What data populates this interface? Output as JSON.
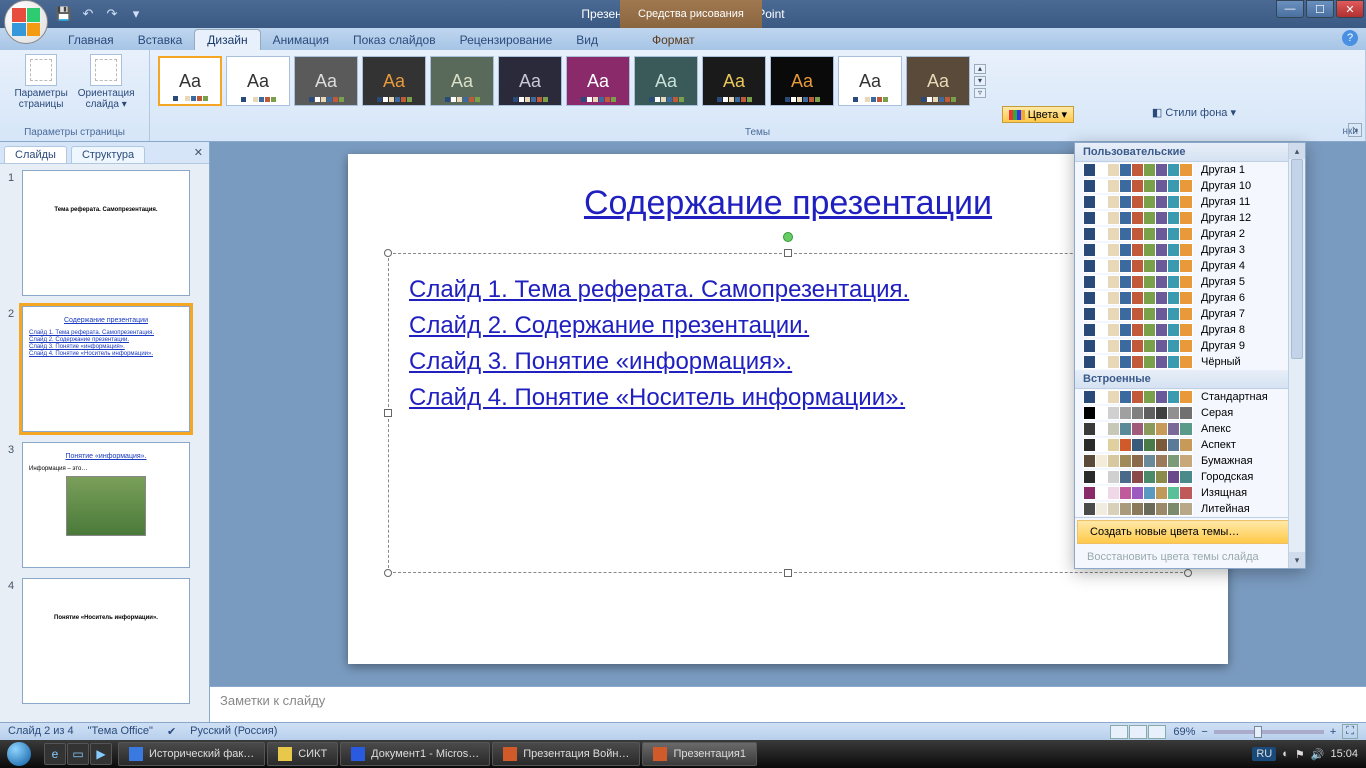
{
  "title": "Презентация1 - Microsoft PowerPoint",
  "drawing_tools": "Средства рисования",
  "tabs": {
    "home": "Главная",
    "insert": "Вставка",
    "design": "Дизайн",
    "anim": "Анимация",
    "show": "Показ слайдов",
    "review": "Рецензирование",
    "view": "Вид",
    "format": "Формат"
  },
  "ribbon": {
    "page_params": "Параметры\nстраницы",
    "orientation": "Ориентация\nслайда ▾",
    "group_page": "Параметры страницы",
    "group_themes": "Темы",
    "colors_btn": "Цвета ▾",
    "bg_styles": "Стили фона ▾",
    "bg_group_tail": "нки"
  },
  "pane": {
    "slides": "Слайды",
    "structure": "Структура"
  },
  "thumbs": {
    "t1": "Тема реферата. Самопрезентация.",
    "t2_title": "Содержание презентации",
    "t2_l1": "Слайд 1. Тема реферата. Самопрезентация.",
    "t2_l2": "Слайд 2. Содержание презентации.",
    "t2_l3": "Слайд 3. Понятие «информация».",
    "t2_l4": "Слайд 4. Понятие «Носитель информации».",
    "t3_title": "Понятие «информация».",
    "t3_sub": "Информация – это…",
    "t4": "Понятие «Носитель информации»."
  },
  "slide": {
    "title": "Содержание презентации",
    "l1": "Слайд 1. Тема реферата. Самопрезентация.",
    "l2": "Слайд 2. Содержание презентации.",
    "l3": "Слайд 3. Понятие «информация».",
    "l4": "Слайд 4. Понятие «Носитель информации»."
  },
  "notes_placeholder": "Заметки к слайду",
  "colors_panel": {
    "hdr_custom": "Пользовательские",
    "hdr_builtin": "Встроенные",
    "custom": [
      "Другая 1",
      "Другая 10",
      "Другая 11",
      "Другая 12",
      "Другая 2",
      "Другая 3",
      "Другая 4",
      "Другая 5",
      "Другая 6",
      "Другая 7",
      "Другая 8",
      "Другая 9",
      "Чёрный"
    ],
    "builtin": [
      "Стандартная",
      "Серая",
      "Апекс",
      "Аспект",
      "Бумажная",
      "Городская",
      "Изящная",
      "Литейная"
    ],
    "create": "Создать новые цвета темы…",
    "restore": "Восстановить цвета темы слайда"
  },
  "status": {
    "slide_of": "Слайд 2 из 4",
    "theme": "\"Тема Office\"",
    "lang": "Русский (Россия)",
    "zoom": "69%"
  },
  "taskbar": {
    "items": [
      "Исторический фак…",
      "СИКТ",
      "Документ1 - Micros…",
      "Презентация Войн…",
      "Презентация1"
    ],
    "lang": "RU",
    "time": "15:04"
  },
  "swatch_sets": {
    "blues": [
      "#2a4a7a",
      "#ffffff",
      "#e8d8b8",
      "#3a6aa0",
      "#c05a3a",
      "#7aa04a",
      "#6a5a9a",
      "#3a9ab0",
      "#e89a3a"
    ],
    "grays": [
      "#000000",
      "#ffffff",
      "#d0d0d0",
      "#a0a0a0",
      "#808080",
      "#606060",
      "#404040",
      "#909090",
      "#707070"
    ],
    "apex": [
      "#3a3a3a",
      "#ffffff",
      "#c8c8b8",
      "#5a8a9a",
      "#a05a7a",
      "#8a9a5a",
      "#c89a5a",
      "#7a6a9a",
      "#5a9a8a"
    ],
    "aspect": [
      "#2a2a2a",
      "#ffffff",
      "#e0d0a0",
      "#d05a2a",
      "#3a5a7a",
      "#4a7a4a",
      "#7a5a3a",
      "#5a7a9a",
      "#c89a5a"
    ],
    "paper": [
      "#5a4a3a",
      "#f4ecd8",
      "#d8c8a0",
      "#a08a5a",
      "#8a6a4a",
      "#6a8a9a",
      "#9a7a5a",
      "#7a9a7a",
      "#c8a87a"
    ],
    "urban": [
      "#2a2a2a",
      "#ffffff",
      "#d0d0d0",
      "#4a6a8a",
      "#8a4a4a",
      "#4a8a6a",
      "#8a8a4a",
      "#6a4a8a",
      "#4a8a8a"
    ],
    "fancy": [
      "#8a2a6a",
      "#ffffff",
      "#f0d8e8",
      "#c05a9a",
      "#9a5ac0",
      "#5a9ac0",
      "#c09a5a",
      "#5ac09a",
      "#c05a5a"
    ],
    "foundry": [
      "#4a4a4a",
      "#f0ece0",
      "#d8d0b8",
      "#a89a7a",
      "#8a7a5a",
      "#6a6a5a",
      "#9a8a6a",
      "#7a8a6a",
      "#b8a888"
    ]
  }
}
